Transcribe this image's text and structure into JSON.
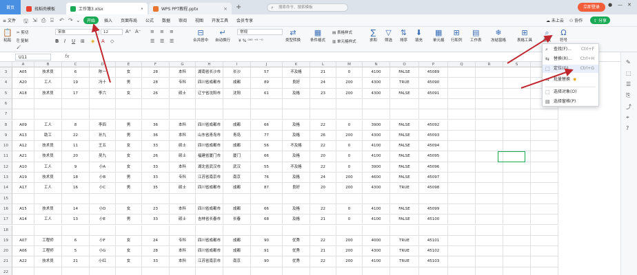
{
  "tabs": {
    "home": "首页",
    "t1": "找稻壳模板",
    "t2": "工作簿3.xlsx",
    "t3": "WPS PPT教程.pptx"
  },
  "search_placeholder": "搜索命令、搜索模板",
  "user": {
    "cloud": "未上云",
    "collab": "协作",
    "share": "分享",
    "login": "立即登录"
  },
  "menus": [
    "文件",
    "开始",
    "插入",
    "页面布局",
    "公式",
    "数据",
    "审阅",
    "视图",
    "开发工具",
    "会员专享"
  ],
  "ribbon": {
    "paste": "粘贴",
    "cut": "剪切",
    "copy": "复制",
    "format_painter": "格式刷",
    "font": "宋体",
    "size": "12",
    "number_format": "常规",
    "merge": "合并居中",
    "wrap": "自动换行",
    "table_style": "表格样式",
    "cond_fmt": "条件格式",
    "cell_style": "单元格样式",
    "type_convert": "类型转换",
    "sum": "求和",
    "filter": "筛选",
    "sort": "排序",
    "fill": "填充",
    "cell": "单元格",
    "rowcol": "行和列",
    "sheet": "工作表",
    "freeze": "冻结窗格",
    "table_tools": "表格工具",
    "find": "查找",
    "symbol": "符号"
  },
  "namebox": "U11",
  "fx": "fx",
  "dropdown": {
    "items": [
      {
        "label": "查找(F)...",
        "shortcut": "Ctrl+F"
      },
      {
        "label": "替换(R)...",
        "shortcut": "Ctrl+H"
      },
      {
        "label": "定位(G)...",
        "shortcut": "Ctrl+G"
      },
      {
        "label": "批量替换",
        "shortcut": ""
      },
      {
        "label": "选择对象(O)",
        "shortcut": ""
      },
      {
        "label": "选择窗格(P)",
        "shortcut": ""
      }
    ]
  },
  "columns": [
    "A",
    "B",
    "C",
    "D",
    "E",
    "F",
    "G",
    "H",
    "I",
    "J",
    "K",
    "L",
    "M",
    "N",
    "O",
    "P",
    "Q",
    "R",
    "S",
    "T"
  ],
  "rows": [
    {
      "n": "3",
      "c": [
        "A05",
        "技术员",
        "6",
        "陈一",
        "女",
        "28",
        "本科",
        "湖南省长沙市",
        "长沙",
        "57",
        "不及格",
        "21",
        "0",
        "4100",
        "FALSE",
        "45089"
      ]
    },
    {
      "n": "4",
      "c": [
        "A20",
        "工人",
        "19",
        "冯十",
        "男",
        "28",
        "专科",
        "四川省成都市",
        "成都",
        "89",
        "良好",
        "24",
        "200",
        "4300",
        "TRUE",
        "45090"
      ]
    },
    {
      "n": "5",
      "c": [
        "A18",
        "技术员",
        "17",
        "李六",
        "女",
        "26",
        "硕士",
        "辽宁省沈阳市",
        "沈阳",
        "61",
        "及格",
        "23",
        "200",
        "4300",
        "FALSE",
        "45091"
      ]
    },
    {
      "n": "6",
      "c": [
        "",
        "",
        "",
        "",
        "",
        "",
        "",
        "",
        "",
        "",
        "",
        "",
        "",
        "",
        "",
        ""
      ]
    },
    {
      "n": "7",
      "c": [
        "",
        "",
        "",
        "",
        "",
        "",
        "",
        "",
        "",
        "",
        "",
        "",
        "",
        "",
        "",
        ""
      ]
    },
    {
      "n": "8",
      "c": [
        "A09",
        "工人",
        "8",
        "李四",
        "男",
        "36",
        "本科",
        "四川省成都市",
        "成都",
        "66",
        "及格",
        "22",
        "0",
        "3900",
        "FALSE",
        "45092"
      ]
    },
    {
      "n": "9",
      "c": [
        "A13",
        "助工",
        "22",
        "孙九",
        "男",
        "36",
        "本科",
        "山东省青岛市",
        "青岛",
        "77",
        "及格",
        "26",
        "200",
        "4300",
        "FALSE",
        "45093"
      ]
    },
    {
      "n": "10",
      "c": [
        "A12",
        "技术员",
        "11",
        "王五",
        "女",
        "33",
        "硕士",
        "四川省成都市",
        "成都",
        "56",
        "不及格",
        "22",
        "0",
        "4100",
        "FALSE",
        "45094"
      ]
    },
    {
      "n": "11",
      "c": [
        "A21",
        "技术员",
        "20",
        "吴九",
        "女",
        "26",
        "硕士",
        "福建省厦门市",
        "厦门",
        "66",
        "及格",
        "20",
        "0",
        "4100",
        "FALSE",
        "45095"
      ]
    },
    {
      "n": "12",
      "c": [
        "A10",
        "工人",
        "9",
        "小A",
        "女",
        "33",
        "本科",
        "湖北省武汉市",
        "武汉",
        "55",
        "不及格",
        "22",
        "0",
        "3900",
        "FALSE",
        "45096"
      ]
    },
    {
      "n": "13",
      "c": [
        "A19",
        "技术员",
        "18",
        "小B",
        "男",
        "33",
        "专科",
        "江苏省南京市",
        "南京",
        "76",
        "及格",
        "24",
        "200",
        "4600",
        "FALSE",
        "45097"
      ]
    },
    {
      "n": "14",
      "c": [
        "A17",
        "工人",
        "16",
        "小C",
        "男",
        "35",
        "硕士",
        "四川省成都市",
        "成都",
        "87",
        "良好",
        "20",
        "200",
        "4300",
        "TRUE",
        "45098"
      ]
    },
    {
      "n": "15",
      "c": [
        "",
        "",
        "",
        "",
        "",
        "",
        "",
        "",
        "",
        "",
        "",
        "",
        "",
        "",
        "",
        ""
      ]
    },
    {
      "n": "16",
      "c": [
        "A15",
        "技术员",
        "14",
        "小D",
        "女",
        "23",
        "本科",
        "四川省成都市",
        "成都",
        "66",
        "及格",
        "22",
        "0",
        "4100",
        "FALSE",
        "45099"
      ]
    },
    {
      "n": "17",
      "c": [
        "A14",
        "工人",
        "13",
        "小E",
        "男",
        "33",
        "硕士",
        "吉林省长春市",
        "长春",
        "68",
        "及格",
        "21",
        "0",
        "4100",
        "FALSE",
        "45100"
      ]
    },
    {
      "n": "18",
      "c": [
        "",
        "",
        "",
        "",
        "",
        "",
        "",
        "",
        "",
        "",
        "",
        "",
        "",
        "",
        "",
        ""
      ]
    },
    {
      "n": "19",
      "c": [
        "A07",
        "工程师",
        "6",
        "小F",
        "女",
        "24",
        "专科",
        "四川省成都市",
        "成都",
        "90",
        "优秀",
        "22",
        "200",
        "4000",
        "TRUE",
        "45101"
      ]
    },
    {
      "n": "20",
      "c": [
        "A06",
        "工程师",
        "5",
        "小G",
        "女",
        "28",
        "本科",
        "四川省成都市",
        "成都",
        "91",
        "优秀",
        "21",
        "200",
        "4300",
        "TRUE",
        "45102"
      ]
    },
    {
      "n": "21",
      "c": [
        "A22",
        "技术员",
        "21",
        "小红",
        "女",
        "33",
        "本科",
        "江苏省南京市",
        "南京",
        "90",
        "优秀",
        "22",
        "200",
        "4100",
        "TRUE",
        "45103"
      ]
    },
    {
      "n": "22",
      "c": [
        "",
        "",
        "",
        "",
        "",
        "",
        "",
        "",
        "",
        "",
        "",
        "",
        "",
        "",
        "",
        ""
      ]
    }
  ],
  "colors": {
    "accent": "#1aaa55",
    "arrow": "#c0262d",
    "blue": "#3b6fb6"
  }
}
